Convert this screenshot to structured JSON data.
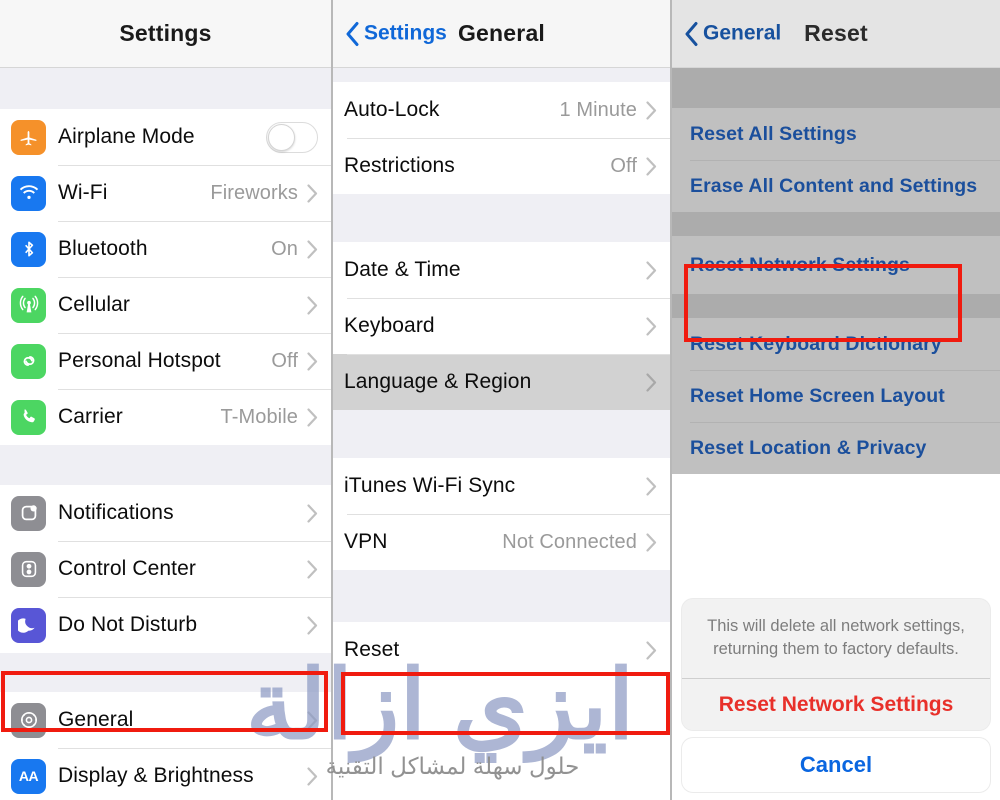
{
  "panels": {
    "settings": {
      "nav": {
        "title": "Settings"
      },
      "groups": [
        {
          "rows": [
            {
              "label": "Airplane Mode",
              "value": "",
              "icon": "airplane-icon",
              "tile_color": "#f5912a",
              "control": "toggle",
              "toggle_on": false
            },
            {
              "label": "Wi-Fi",
              "value": "Fireworks",
              "icon": "wifi-icon",
              "tile_color": "#1878f0"
            },
            {
              "label": "Bluetooth",
              "value": "On",
              "icon": "bluetooth-icon",
              "tile_color": "#1878f0"
            },
            {
              "label": "Cellular",
              "value": "",
              "icon": "cellular-antenna-icon",
              "tile_color": "#4cd662"
            },
            {
              "label": "Personal Hotspot",
              "value": "Off",
              "icon": "hotspot-link-icon",
              "tile_color": "#4cd662"
            },
            {
              "label": "Carrier",
              "value": "T-Mobile",
              "icon": "phone-handset-icon",
              "tile_color": "#4cd662"
            }
          ]
        },
        {
          "rows": [
            {
              "label": "Notifications",
              "value": "",
              "icon": "notifications-icon",
              "tile_color": "#8e8e93"
            },
            {
              "label": "Control Center",
              "value": "",
              "icon": "control-center-icon",
              "tile_color": "#8e8e93"
            },
            {
              "label": "Do Not Disturb",
              "value": "",
              "icon": "moon-icon",
              "tile_color": "#5856d6"
            }
          ]
        },
        {
          "rows": [
            {
              "label": "General",
              "value": "",
              "icon": "gear-icon",
              "tile_color": "#8e8e93",
              "highlighted": true
            },
            {
              "label": "Display & Brightness",
              "value": "",
              "icon": "display-brightness-icon",
              "tile_color": "#1878f0",
              "tile_text": "AA"
            }
          ]
        }
      ]
    },
    "general": {
      "nav": {
        "back_label": "Settings",
        "title": "General"
      },
      "groups": [
        {
          "rows": [
            {
              "label": "Auto-Lock",
              "value": "1 Minute"
            },
            {
              "label": "Restrictions",
              "value": "Off"
            }
          ]
        },
        {
          "rows": [
            {
              "label": "Date & Time",
              "value": ""
            },
            {
              "label": "Keyboard",
              "value": ""
            },
            {
              "label": "Language & Region",
              "value": "",
              "selected": true
            }
          ]
        },
        {
          "rows": [
            {
              "label": "iTunes Wi-Fi Sync",
              "value": ""
            },
            {
              "label": "VPN",
              "value": "Not Connected"
            }
          ]
        },
        {
          "rows": [
            {
              "label": "Reset",
              "value": "",
              "highlighted": true
            }
          ]
        }
      ]
    },
    "reset": {
      "nav": {
        "back_label": "General",
        "title": "Reset"
      },
      "groups": [
        {
          "rows": [
            {
              "label": "Reset All Settings"
            },
            {
              "label": "Erase All Content and Settings"
            }
          ]
        },
        {
          "rows": [
            {
              "label": "Reset Network Settings",
              "highlighted": true
            }
          ]
        },
        {
          "rows": [
            {
              "label": "Reset Keyboard Dictionary"
            },
            {
              "label": "Reset Home Screen Layout"
            },
            {
              "label": "Reset Location & Privacy"
            }
          ]
        }
      ],
      "action_sheet": {
        "message": "This will delete all network settings, returning them to factory defaults.",
        "destructive_label": "Reset Network Settings",
        "cancel_label": "Cancel"
      }
    }
  },
  "watermark": {
    "main": "ايزي ازالة",
    "sub": "حلول سهلة لمشاكل التقنية"
  },
  "colors": {
    "accent_blue": "#1068d8",
    "destructive_red": "#e8302a",
    "highlight_red": "#f01b0f",
    "list_separator": "#e0e0e0",
    "group_background": "#efeff4"
  }
}
